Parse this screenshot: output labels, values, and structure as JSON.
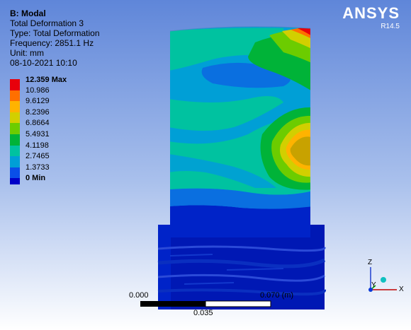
{
  "info": {
    "title": "B: Modal",
    "result_name": "Total Deformation 3",
    "type_line": "Type: Total Deformation",
    "frequency_line": "Frequency: 2851.1 Hz",
    "unit_line": "Unit: mm",
    "date_line": "08-10-2021 10:10"
  },
  "legend": {
    "entries": [
      {
        "label": "12.359 Max",
        "color": "#e8000b",
        "bold": true
      },
      {
        "label": "10.986",
        "color": "#ff6f00",
        "bold": false
      },
      {
        "label": "9.6129",
        "color": "#ffb300",
        "bold": false
      },
      {
        "label": "8.2396",
        "color": "#d2cf00",
        "bold": false
      },
      {
        "label": "6.8664",
        "color": "#6ccc00",
        "bold": false
      },
      {
        "label": "5.4931",
        "color": "#00b338",
        "bold": false
      },
      {
        "label": "4.1198",
        "color": "#00c2a0",
        "bold": false
      },
      {
        "label": "2.7465",
        "color": "#009fd6",
        "bold": false
      },
      {
        "label": "1.3733",
        "color": "#0a4fe8",
        "bold": false
      },
      {
        "label": "0 Min",
        "color": "#0000c8",
        "bold": true
      }
    ]
  },
  "brand": {
    "name": "ANSYS",
    "version": "R14.5"
  },
  "scale_bar": {
    "start": "0.000",
    "mid": "0.035",
    "end": "0.070 (m)"
  },
  "triad": {
    "z": "Z",
    "y": "Y",
    "x": "X"
  },
  "colors": {
    "background_top": "#5f86d9",
    "background_bottom": "#ffffff",
    "base": "#0018b4"
  }
}
